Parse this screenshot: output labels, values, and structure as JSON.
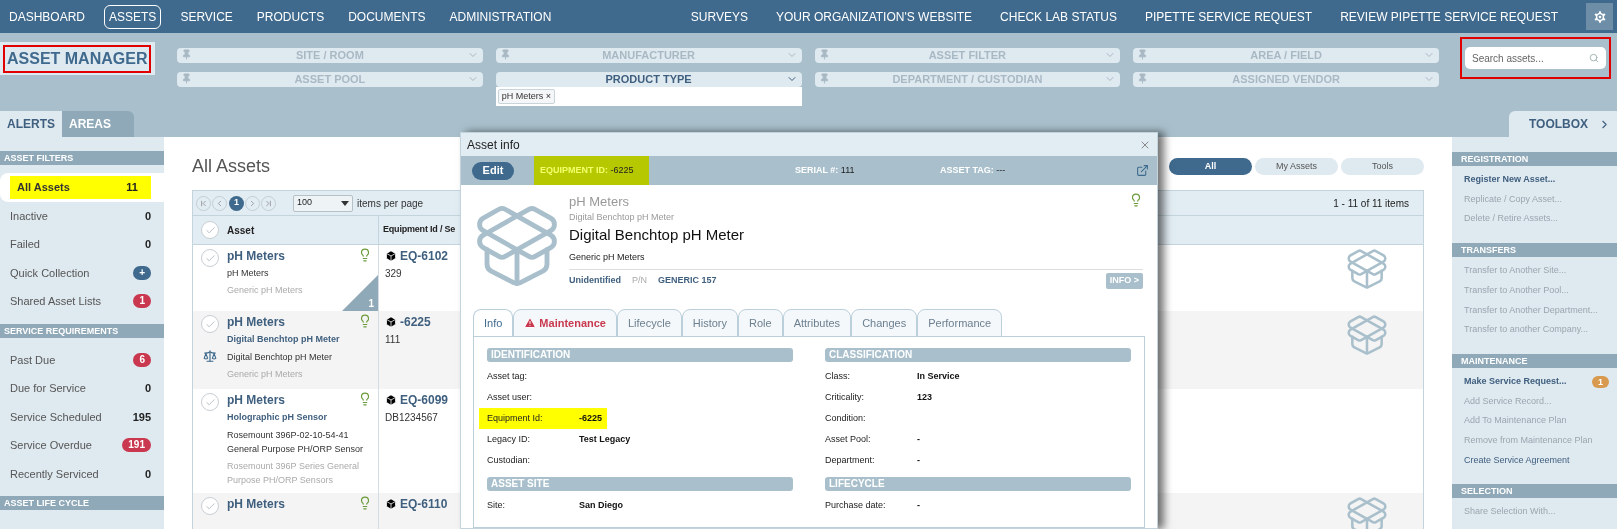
{
  "top_nav": {
    "left": [
      {
        "label": "DASHBOARD",
        "selected": false
      },
      {
        "label": "ASSETS",
        "selected": true
      },
      {
        "label": "SERVICE",
        "selected": false
      },
      {
        "label": "PRODUCTS",
        "selected": false
      },
      {
        "label": "DOCUMENTS",
        "selected": false
      },
      {
        "label": "ADMINISTRATION",
        "selected": false
      }
    ],
    "right": [
      {
        "label": "SURVEYS"
      },
      {
        "label": "YOUR ORGANIZATION'S WEBSITE"
      },
      {
        "label": "CHECK LAB STATUS"
      },
      {
        "label": "PIPETTE SERVICE REQUEST"
      },
      {
        "label": "REVIEW PIPETTE SERVICE REQUEST"
      }
    ]
  },
  "page_title": {
    "text": "ASSET MANAGER",
    "outlined": true
  },
  "filters": [
    {
      "label": "SITE / ROOM",
      "active": false
    },
    {
      "label": "MANUFACTURER",
      "active": false
    },
    {
      "label": "ASSET FILTER",
      "active": false
    },
    {
      "label": "AREA / FIELD",
      "active": false
    },
    {
      "label": "ASSET POOL",
      "active": false
    },
    {
      "label": "PRODUCT TYPE",
      "active": true,
      "tags": [
        {
          "label": "pH Meters",
          "remove": "×"
        }
      ]
    },
    {
      "label": "DEPARTMENT / CUSTODIAN",
      "active": false
    },
    {
      "label": "ASSIGNED VENDOR",
      "active": false
    }
  ],
  "search": {
    "placeholder": "Search assets...",
    "outlined": true
  },
  "left_tabs": [
    {
      "label": "ALERTS",
      "selected": true
    },
    {
      "label": "AREAS",
      "selected": false
    }
  ],
  "toolbox": {
    "label": "TOOLBOX"
  },
  "sidebar": [
    {
      "title": "ASSET FILTERS",
      "items": [
        {
          "label": "All Assets",
          "count": "11",
          "selected": true
        },
        {
          "label": "Inactive",
          "count": "0",
          "selected": false
        },
        {
          "label": "Failed",
          "count": "0",
          "selected": false
        },
        {
          "label": "Quick Collection",
          "count": "+",
          "selected": false,
          "color": "#3f6a8d"
        },
        {
          "label": "Shared Asset Lists",
          "count": "1",
          "selected": false,
          "color": "#c9384f"
        }
      ]
    },
    {
      "title": "SERVICE REQUIREMENTS",
      "items": [
        {
          "label": "Past Due",
          "count": "6",
          "selected": false,
          "color": "#c9384f"
        },
        {
          "label": "Due for Service",
          "count": "0",
          "selected": false
        },
        {
          "label": "Service Scheduled",
          "count": "195",
          "selected": false
        },
        {
          "label": "Service Overdue",
          "count": "191",
          "selected": false,
          "color": "#c9384f"
        },
        {
          "label": "Recently Serviced",
          "count": "0",
          "selected": false
        }
      ]
    },
    {
      "title": "ASSET LIFE CYCLE"
    }
  ],
  "main": {
    "title": "All Assets",
    "views": [
      {
        "label": "All",
        "selected": true
      },
      {
        "label": "My Assets",
        "selected": false
      },
      {
        "label": "Tools",
        "selected": false
      }
    ],
    "pager": {
      "pages": [
        {
          "label": "1",
          "selected": true
        }
      ],
      "page_size": "100",
      "page_size_label": "items per page",
      "summary": "1 - 11 of 11 items"
    },
    "columns": [
      "Asset",
      "Equipment Id / Se"
    ],
    "select_all_checked": false,
    "rows": [
      {
        "name": "pH Meters",
        "description": "pH Meters",
        "product": "Generic pH Meters",
        "equipment_id": "EQ-6102",
        "serial": "329",
        "calibration": false,
        "corner_count": "1",
        "thumbnail": true,
        "checked": false
      },
      {
        "name": "pH Meters",
        "model": "Digital Benchtop pH Meter",
        "description": "Digital Benchtop pH Meter",
        "product": "Generic pH Meters",
        "equipment_id": "-6225",
        "serial": "111",
        "calibration": true,
        "thumbnail": true,
        "checked": false
      },
      {
        "name": "pH Meters",
        "model": "Holographic pH Sensor",
        "description": "Rosemount 396P-02-10-54-41 General Purpose PH/ORP Sensor",
        "product": "Rosemount 396P Series General Purpose PH/ORP Sensors",
        "equipment_id": "EQ-6099",
        "serial": "DB1234567",
        "calibration": false,
        "thumbnail": false,
        "checked": false
      },
      {
        "name": "pH Meters",
        "equipment_id": "EQ-6110",
        "calibration": false,
        "thumbnail": true,
        "checked": false
      }
    ]
  },
  "modal": {
    "title": "Asset info",
    "edit": "Edit",
    "header": [
      {
        "label": "EQUIPMENT ID:",
        "value": "-6225",
        "highlighted": true
      },
      {
        "label": "SERIAL #:",
        "value": "111",
        "highlighted": false
      },
      {
        "label": "ASSET TAG:",
        "value": "---",
        "highlighted": false
      }
    ],
    "product_type": "pH Meters",
    "model_small": "Digital Benchtop pH Meter",
    "model": "Digital Benchtop pH Meter",
    "product": "Generic pH Meters",
    "status": "Unidentified",
    "pn_label": "P/N",
    "pn": "GENERIC 157",
    "info_button": "INFO >",
    "tabs": [
      {
        "label": "Info",
        "selected": true,
        "warning": false
      },
      {
        "label": "Maintenance",
        "selected": false,
        "warning": true
      },
      {
        "label": "Lifecycle",
        "selected": false,
        "warning": false
      },
      {
        "label": "History",
        "selected": false,
        "warning": false
      },
      {
        "label": "Role",
        "selected": false,
        "warning": false
      },
      {
        "label": "Attributes",
        "selected": false,
        "warning": false
      },
      {
        "label": "Changes",
        "selected": false,
        "warning": false
      },
      {
        "label": "Performance",
        "selected": false,
        "warning": false
      }
    ],
    "columns": [
      [
        {
          "title": "IDENTIFICATION",
          "fields": [
            {
              "label": "Asset tag:",
              "highlighted": false
            },
            {
              "label": "Asset user:",
              "highlighted": false
            },
            {
              "label": "Equipment Id:",
              "value": "-6225",
              "highlighted": true
            },
            {
              "label": "Legacy ID:",
              "value": "Test Legacy",
              "highlighted": false
            },
            {
              "label": "Custodian:",
              "highlighted": false
            }
          ]
        },
        {
          "title": "ASSET SITE",
          "fields": [
            {
              "label": "Site:",
              "value": "San Diego",
              "highlighted": false
            }
          ]
        }
      ],
      [
        {
          "title": "CLASSIFICATION",
          "fields": [
            {
              "label": "Class:",
              "value": "In Service",
              "highlighted": false
            },
            {
              "label": "Criticality:",
              "value": "123",
              "highlighted": false
            },
            {
              "label": "Condition:",
              "highlighted": false
            },
            {
              "label": "Asset Pool:",
              "value": "-",
              "highlighted": false
            },
            {
              "label": "Department:",
              "value": "-",
              "highlighted": false
            }
          ]
        },
        {
          "title": "LIFECYCLE",
          "fields": [
            {
              "label": "Purchase date:",
              "value": "-",
              "highlighted": false
            }
          ]
        }
      ]
    ]
  },
  "toolbox_sections": [
    {
      "title": "REGISTRATION",
      "items": [
        {
          "label": "Register New Asset...",
          "enabled": true,
          "strong": true
        },
        {
          "label": "Replicate / Copy Asset...",
          "enabled": false,
          "strong": false
        },
        {
          "label": "Delete / Retire Assets...",
          "enabled": false,
          "strong": false
        }
      ]
    },
    {
      "title": "TRANSFERS",
      "items": [
        {
          "label": "Transfer to Another Site...",
          "enabled": false,
          "strong": false
        },
        {
          "label": "Transfer to Another Pool...",
          "enabled": false,
          "strong": false
        },
        {
          "label": "Transfer to Another Department...",
          "enabled": false,
          "strong": false
        },
        {
          "label": "Transfer to another Company...",
          "enabled": false,
          "strong": false
        }
      ]
    },
    {
      "title": "MAINTENANCE",
      "items": [
        {
          "label": "Make Service Request...",
          "enabled": true,
          "strong": true,
          "count": "1",
          "color": "#d89a4f"
        },
        {
          "label": "Add Service Record...",
          "enabled": false,
          "strong": false
        },
        {
          "label": "Add To Maintenance Plan",
          "enabled": false,
          "strong": false
        },
        {
          "label": "Remove from Maintenance Plan",
          "enabled": false,
          "strong": false
        },
        {
          "label": "Create Service Agreement",
          "enabled": true,
          "strong": false
        }
      ]
    },
    {
      "title": "SELECTION",
      "items": [
        {
          "label": "Share Selection With...",
          "enabled": false,
          "strong": false
        }
      ]
    }
  ]
}
